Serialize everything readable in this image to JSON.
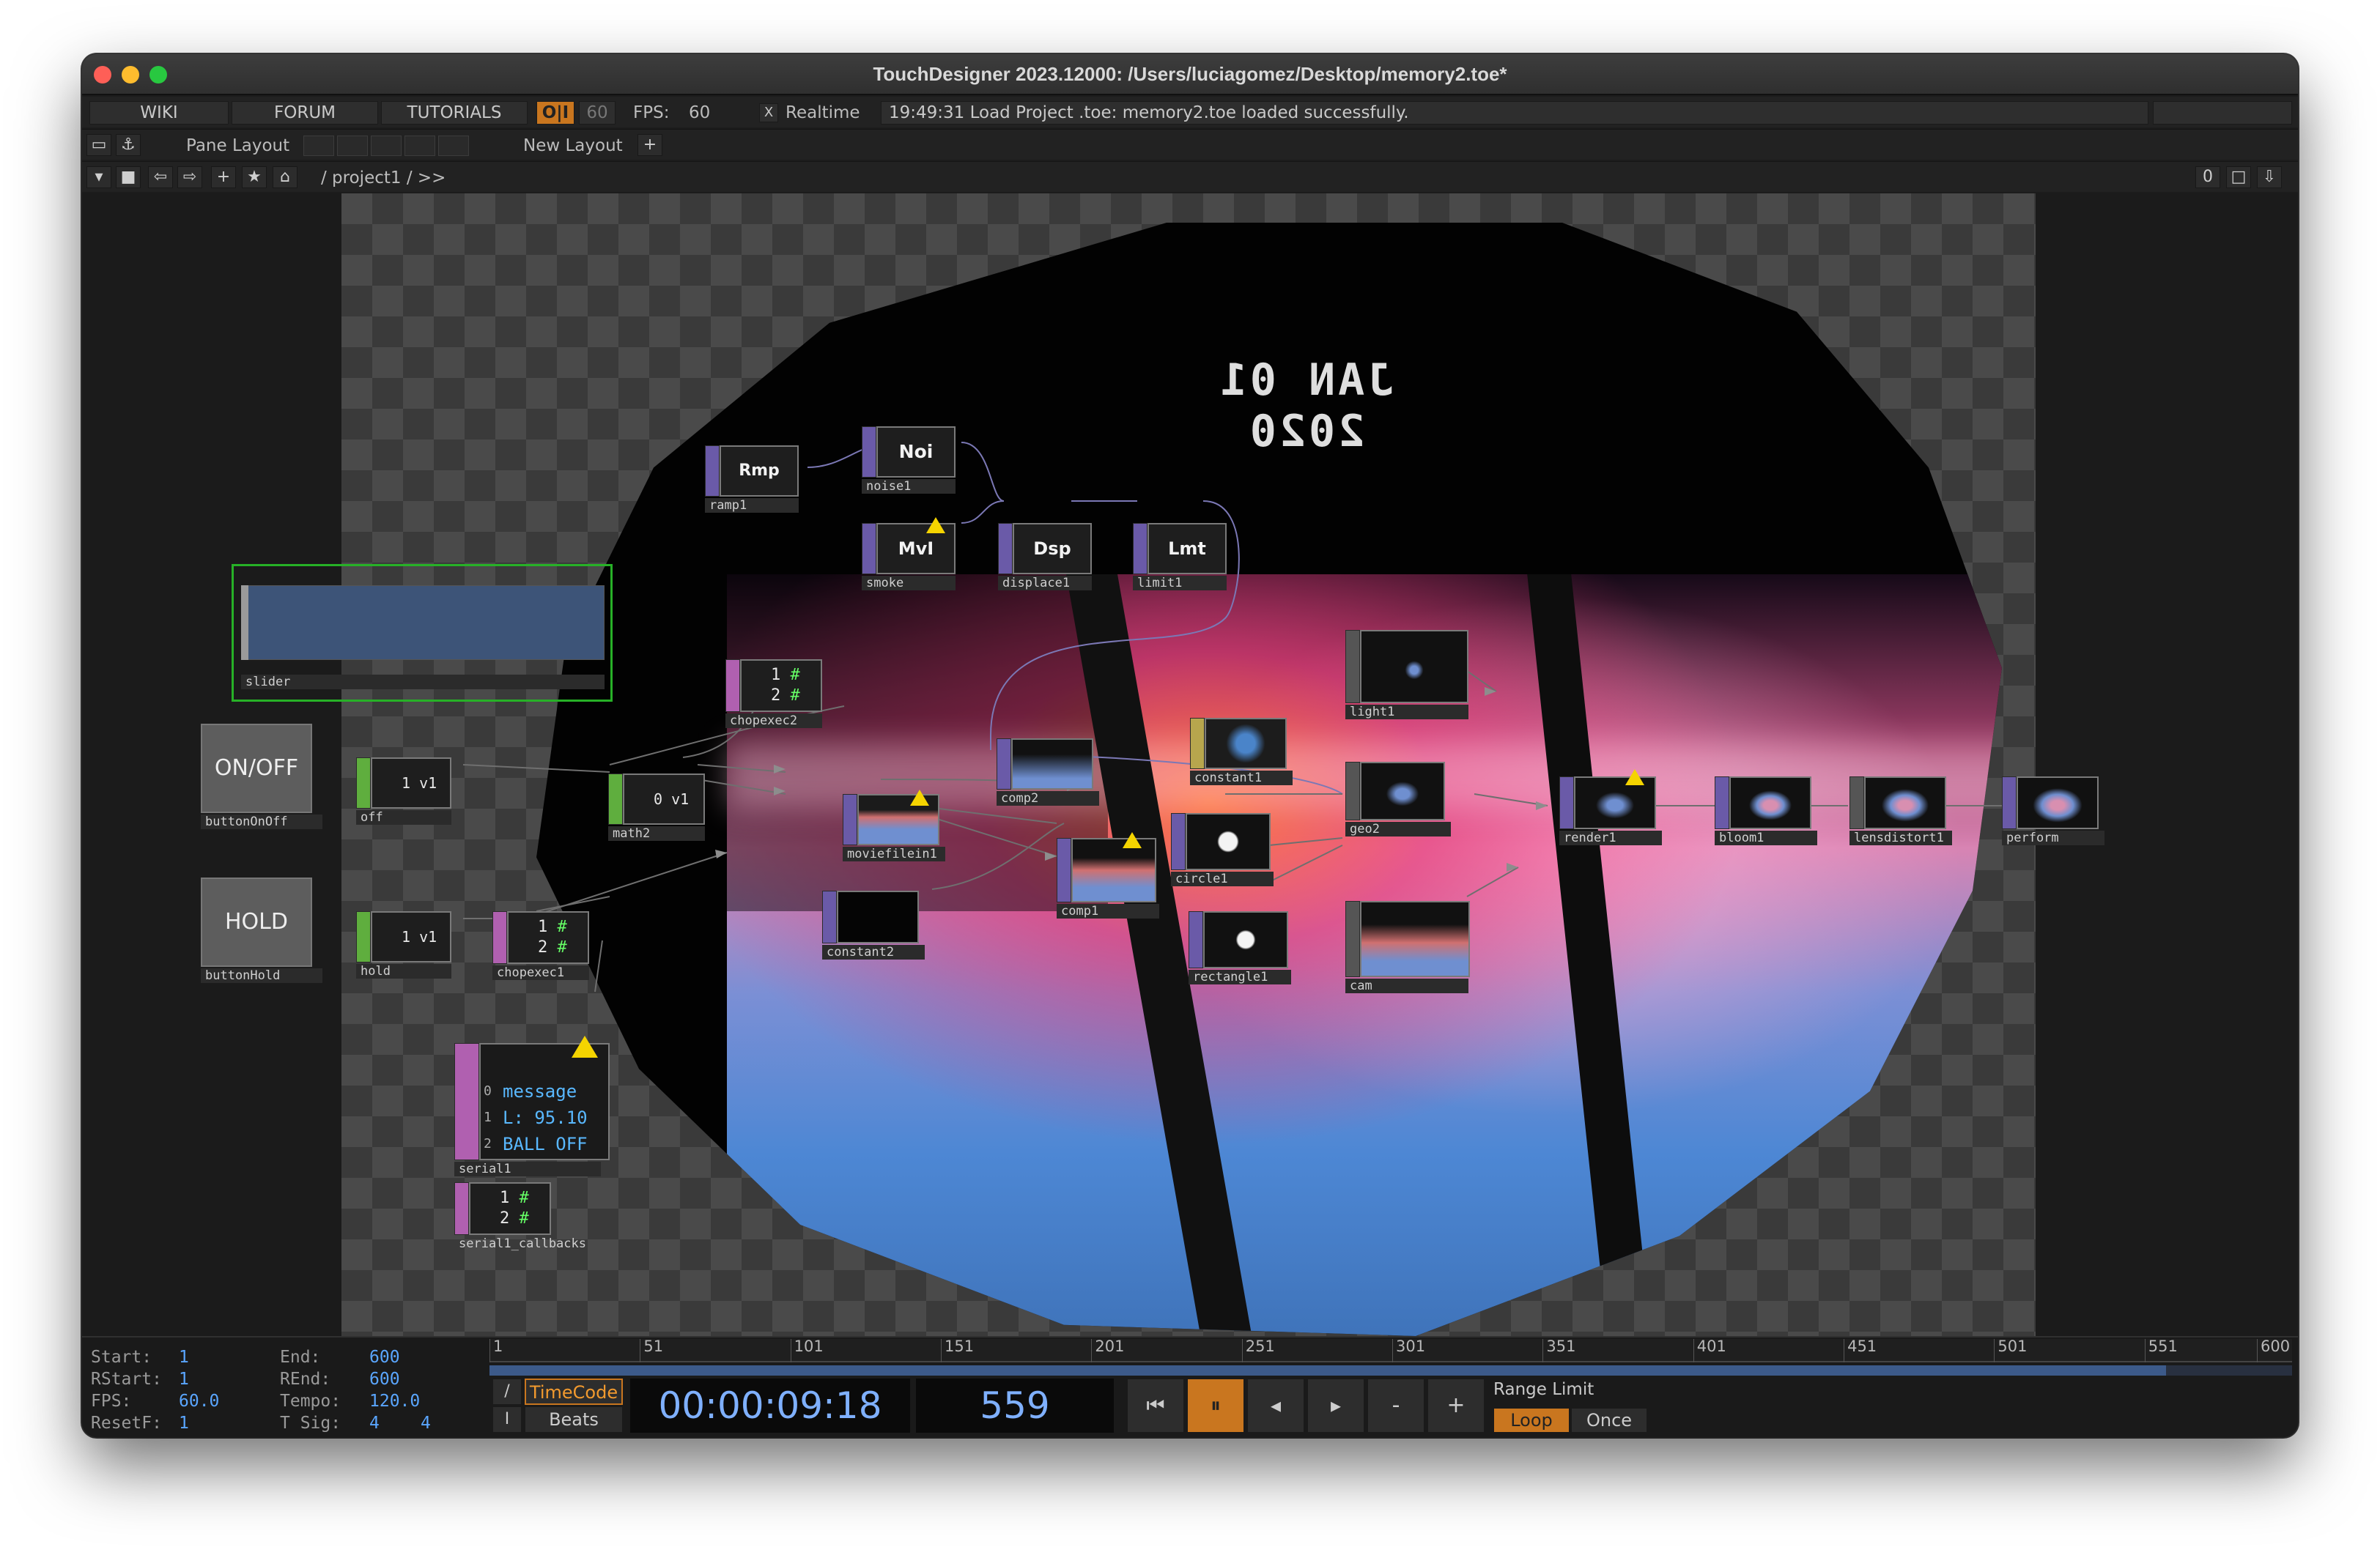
{
  "window": {
    "title": "TouchDesigner 2023.12000: /Users/luciagomez/Desktop/memory2.toe*"
  },
  "menubar": {
    "wiki": "WIKI",
    "forum": "FORUM",
    "tutorials": "TUTORIALS",
    "oi": "O|I",
    "fps_target": "60",
    "fps_label": "FPS:",
    "fps_value": "60",
    "realtime_check": "X",
    "realtime": "Realtime",
    "status": "19:49:31 Load Project .toe: memory2.toe loaded successfully."
  },
  "panebar": {
    "pane_layout": "Pane Layout",
    "new_layout": "New Layout",
    "add": "+"
  },
  "pathbar": {
    "path": "/ project1 / >>",
    "counter": "0"
  },
  "viewer": {
    "date_text": "JAN 01 2020"
  },
  "nodes": {
    "ramp1": {
      "op": "Rmp",
      "name": "ramp1"
    },
    "noise1": {
      "op": "Noi",
      "name": "noise1"
    },
    "smoke": {
      "op": "MvI",
      "name": "smoke"
    },
    "displace1": {
      "op": "Dsp",
      "name": "displace1"
    },
    "limit1": {
      "op": "Lmt",
      "name": "limit1"
    },
    "slider": {
      "name": "slider"
    },
    "chopexec2": {
      "l1": "1",
      "l1b": "#",
      "l2": "2",
      "l2b": "#",
      "name": "chopexec2"
    },
    "buttonOnOff": {
      "label": "ON/OFF",
      "name": "buttonOnOff"
    },
    "off": {
      "val": "1",
      "chan": "v1",
      "name": "off"
    },
    "math2": {
      "val": "0",
      "chan": "v1",
      "name": "math2"
    },
    "moviefilein1": {
      "name": "moviefilein1"
    },
    "comp2": {
      "name": "comp2"
    },
    "constant1": {
      "name": "constant1"
    },
    "light1": {
      "name": "light1"
    },
    "geo2": {
      "name": "geo2"
    },
    "render1": {
      "name": "render1"
    },
    "bloom1": {
      "name": "bloom1"
    },
    "lensdistort1": {
      "name": "lensdistort1"
    },
    "perform": {
      "name": "perform"
    },
    "comp1": {
      "name": "comp1"
    },
    "circle1": {
      "name": "circle1"
    },
    "rectangle1": {
      "name": "rectangle1"
    },
    "cam": {
      "name": "cam"
    },
    "constant2": {
      "name": "constant2"
    },
    "buttonHold": {
      "label": "HOLD",
      "name": "buttonHold"
    },
    "hold": {
      "val": "1",
      "chan": "v1",
      "name": "hold"
    },
    "chopexec1": {
      "l1": "1",
      "l1b": "#",
      "l2": "2",
      "l2b": "#",
      "name": "chopexec1"
    },
    "serial1": {
      "r0i": "0",
      "r0": "message",
      "r1i": "1",
      "r1": "L: 95.10",
      "r2i": "2",
      "r2": "BALL OFF",
      "name": "serial1"
    },
    "serial1_callbacks": {
      "l1": "1",
      "l1b": "#",
      "l2": "2",
      "l2b": "#",
      "name": "serial1_callbacks"
    }
  },
  "timeline": {
    "start_k": "Start:",
    "start_v": "1",
    "rstart_k": "RStart:",
    "rstart_v": "1",
    "fps_k": "FPS:",
    "fps_v": "60.0",
    "resetf_k": "ResetF:",
    "resetf_v": "1",
    "end_k": "End:",
    "end_v": "600",
    "rend_k": "REnd:",
    "rend_v": "600",
    "tempo_k": "Tempo:",
    "tempo_v": "120.0",
    "tsig_k": "T Sig:",
    "tsig_v1": "4",
    "tsig_v2": "4",
    "ticks": [
      "1",
      "51",
      "101",
      "151",
      "201",
      "251",
      "301",
      "351",
      "401",
      "451",
      "501",
      "551",
      "600"
    ],
    "progress": 0.93,
    "timecode_btn": "TimeCode",
    "beats_btn": "Beats",
    "timecode": "00:00:09:18",
    "frame": "559",
    "range_limit": "Range Limit",
    "loop": "Loop",
    "once": "Once",
    "minus": "-",
    "plus": "+"
  },
  "colors": {
    "accent_orange": "#c9761f",
    "slider_fill": "#3d5478",
    "warning": "#f5d400"
  }
}
